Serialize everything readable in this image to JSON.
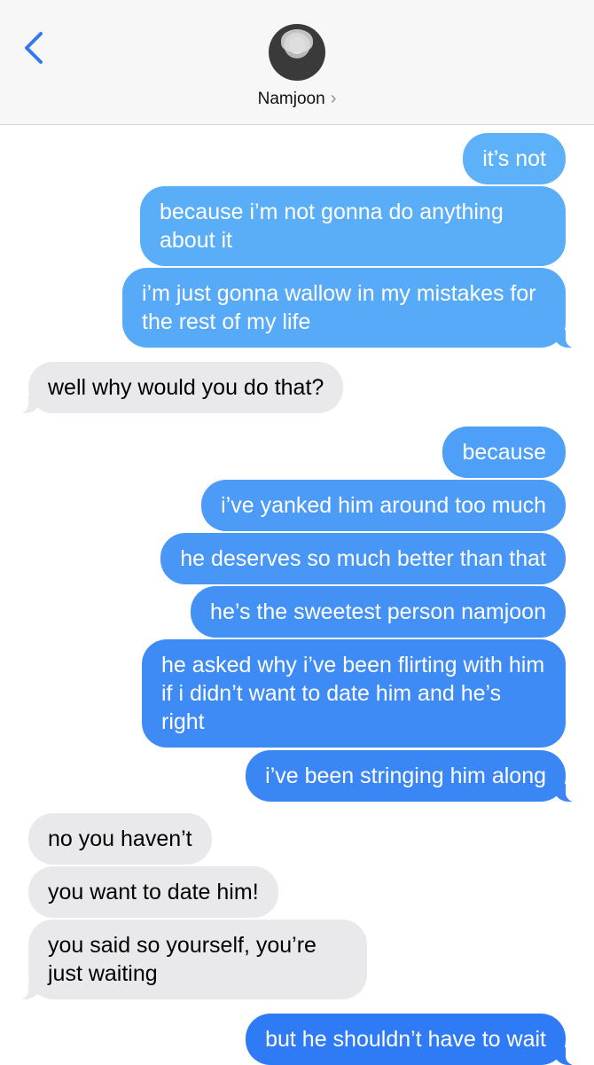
{
  "header": {
    "contact_name": "Namjoon",
    "chevron": "›"
  },
  "colors": {
    "incoming_bubble": "#e9e9eb",
    "outgoing_top": "#5cb0f8",
    "outgoing_bottom": "#2f7bf5",
    "back_icon": "#3478f6"
  },
  "messages": [
    {
      "from": "me",
      "text": "it’s not"
    },
    {
      "from": "me",
      "text": "because i’m not gonna do anything about it"
    },
    {
      "from": "me",
      "text": "i’m just gonna wallow in my mistakes for the rest of my life"
    },
    {
      "from": "them",
      "text": "well why would you do that?"
    },
    {
      "from": "me",
      "text": "because"
    },
    {
      "from": "me",
      "text": "i’ve yanked him around too much"
    },
    {
      "from": "me",
      "text": "he deserves so much better than that"
    },
    {
      "from": "me",
      "text": "he’s the sweetest person namjoon"
    },
    {
      "from": "me",
      "text": "he asked why i’ve been flirting with him if i didn’t want to date him and he’s right"
    },
    {
      "from": "me",
      "text": "i’ve been stringing him along"
    },
    {
      "from": "them",
      "text": "no you haven’t"
    },
    {
      "from": "them",
      "text": "you want to date him!"
    },
    {
      "from": "them",
      "text": "you said so yourself, you’re just waiting"
    },
    {
      "from": "me",
      "text": "but he shouldn’t have to wait"
    }
  ]
}
